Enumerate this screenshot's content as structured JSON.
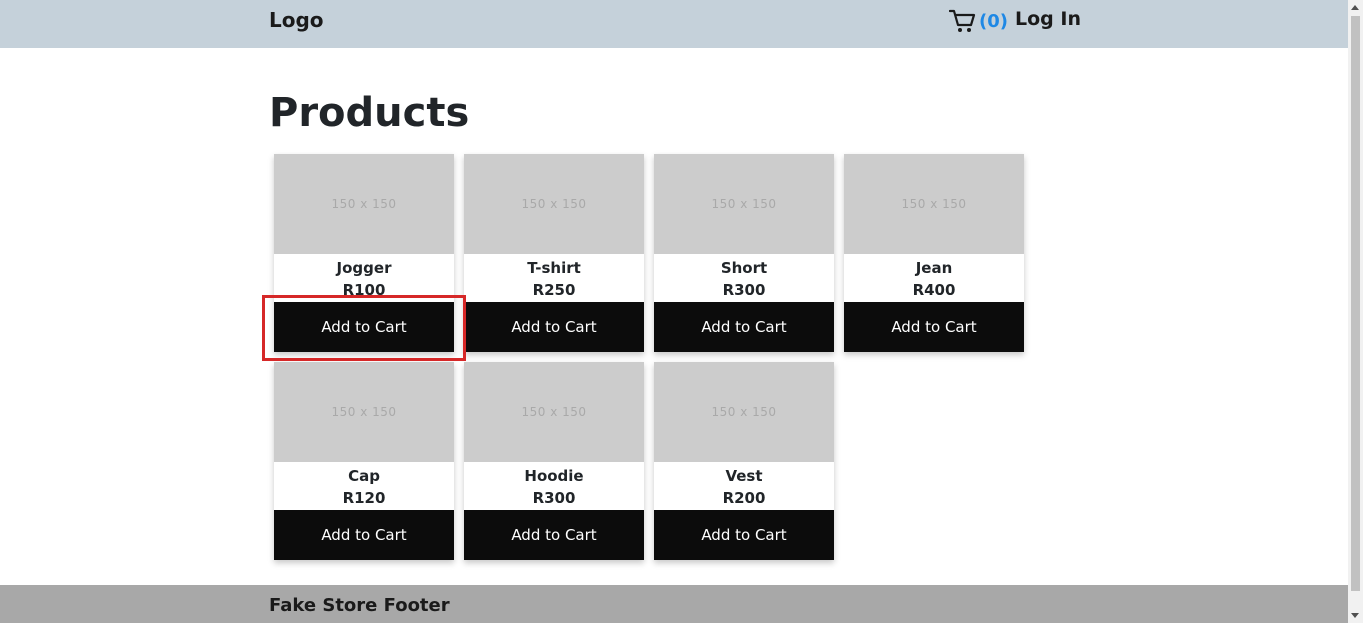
{
  "header": {
    "logo": "Logo",
    "cart_count": "(0)",
    "login_label": "Log In"
  },
  "main": {
    "title": "Products",
    "products": [
      {
        "placeholder": "150 x 150",
        "name": "Jogger",
        "price": "R100",
        "button": "Add to Cart"
      },
      {
        "placeholder": "150 x 150",
        "name": "T-shirt",
        "price": "R250",
        "button": "Add to Cart"
      },
      {
        "placeholder": "150 x 150",
        "name": "Short",
        "price": "R300",
        "button": "Add to Cart"
      },
      {
        "placeholder": "150 x 150",
        "name": "Jean",
        "price": "R400",
        "button": "Add to Cart"
      },
      {
        "placeholder": "150 x 150",
        "name": "Cap",
        "price": "R120",
        "button": "Add to Cart"
      },
      {
        "placeholder": "150 x 150",
        "name": "Hoodie",
        "price": "R300",
        "button": "Add to Cart"
      },
      {
        "placeholder": "150 x 150",
        "name": "Vest",
        "price": "R200",
        "button": "Add to Cart"
      }
    ]
  },
  "footer": {
    "text": "Fake Store Footer"
  },
  "colors": {
    "navbar": "#c5d1da",
    "cart_count": "#1e88e5",
    "button": "#0c0c0c",
    "highlight": "#d62828",
    "footer": "#a8a8a8"
  },
  "icons": {
    "cart": "cart-icon"
  }
}
